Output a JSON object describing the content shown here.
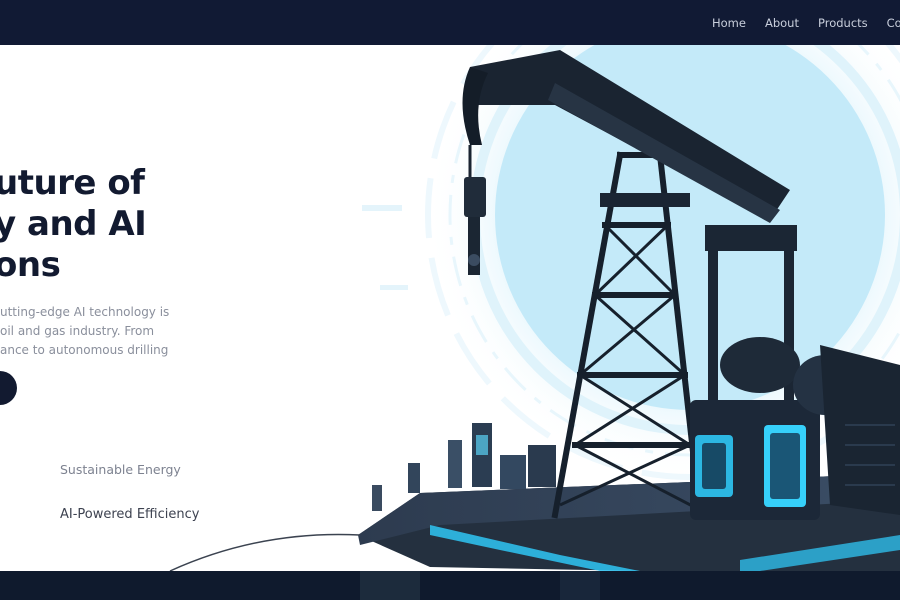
{
  "nav": {
    "items": [
      {
        "label": "Home"
      },
      {
        "label": "About"
      },
      {
        "label": "Products"
      },
      {
        "label": "Cont"
      }
    ]
  },
  "hero": {
    "headline_lines": [
      "uture of",
      "y and AI",
      "ons"
    ],
    "description_lines": [
      "utting-edge AI technology is",
      "oil and gas industry. From",
      "ance to autonomous drilling"
    ],
    "features": [
      "Sustainable Energy",
      "AI-Powered Efficiency"
    ]
  },
  "colors": {
    "nav_background": "#111a34",
    "headline": "#121a30",
    "accent_glow": "#2fc6f5",
    "bottom_band": "#0f1a2d"
  },
  "icons": {
    "cta": "circle-button",
    "hero_image": "oil-pumpjack-illustration"
  }
}
